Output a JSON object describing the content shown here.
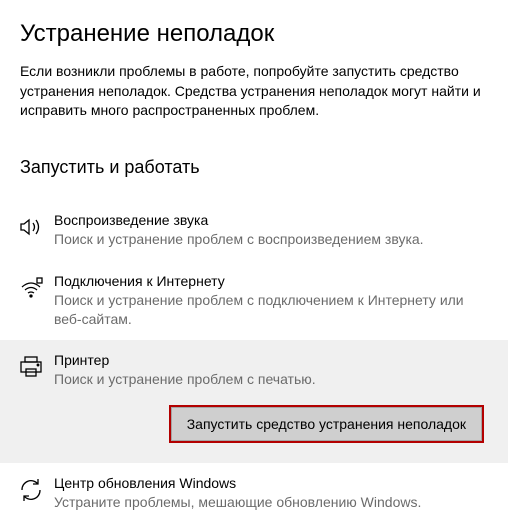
{
  "page": {
    "title": "Устранение неполадок",
    "description": "Если возникли проблемы в работе, попробуйте запустить средство устранения неполадок. Средства устранения неполадок могут найти и исправить много распространенных проблем."
  },
  "section": {
    "title": "Запустить и работать"
  },
  "items": [
    {
      "icon": "audio",
      "title": "Воспроизведение звука",
      "desc": "Поиск и устранение проблем с воспроизведением звука.",
      "selected": false
    },
    {
      "icon": "wifi",
      "title": "Подключения к Интернету",
      "desc": "Поиск и устранение проблем с подключением к Интернету или веб-сайтам.",
      "selected": false
    },
    {
      "icon": "printer",
      "title": "Принтер",
      "desc": "Поиск и устранение проблем с печатью.",
      "selected": true
    },
    {
      "icon": "update",
      "title": "Центр обновления Windows",
      "desc": "Устраните проблемы, мешающие обновлению Windows.",
      "selected": false
    }
  ],
  "run_button": "Запустить средство устранения неполадок"
}
